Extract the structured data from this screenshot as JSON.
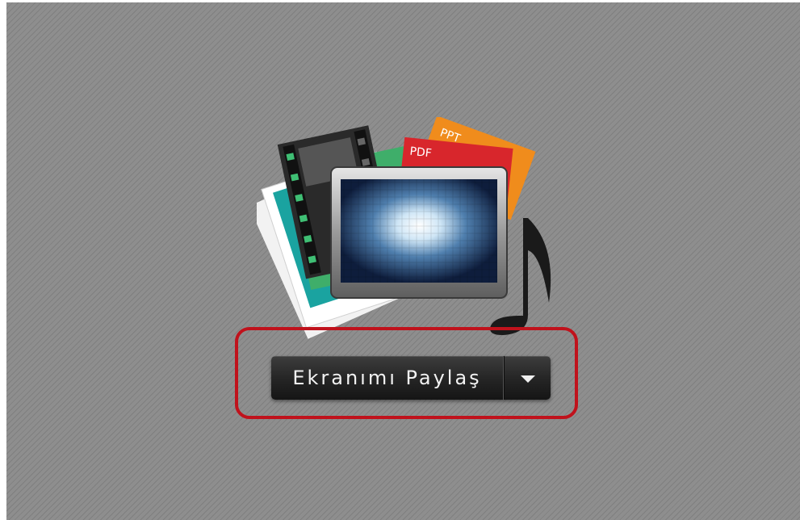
{
  "illustration": {
    "icon": "media-share-icon",
    "ppt_label": "PPT",
    "pdf_label": "PDF"
  },
  "share": {
    "button_label": "Ekranımı Paylaş",
    "dropdown_icon": "chevron-down-icon"
  },
  "colors": {
    "highlight": "#c0121c",
    "button_bg": "#262626",
    "background": "#8a8a8a"
  }
}
